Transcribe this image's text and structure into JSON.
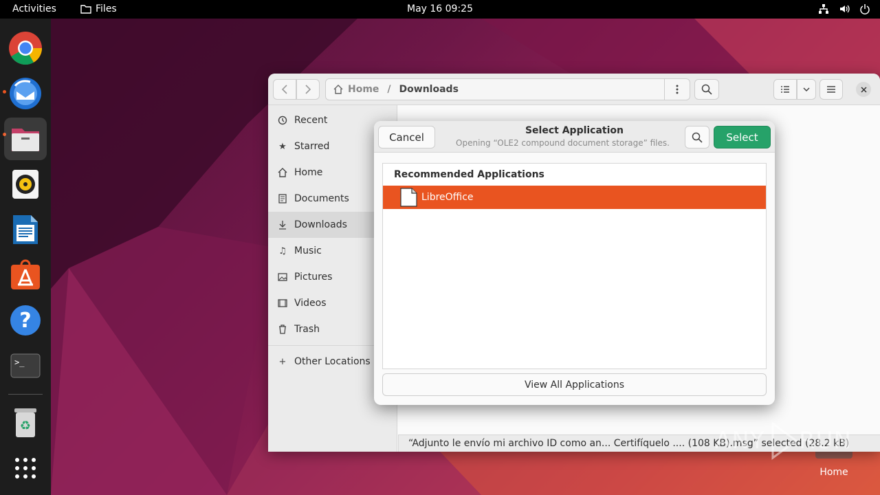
{
  "topbar": {
    "activities": "Activities",
    "app_name": "Files",
    "clock": "May 16  09:25"
  },
  "dock": {
    "items": [
      {
        "name": "chrome",
        "icon": "chrome-icon"
      },
      {
        "name": "thunderbird",
        "icon": "thunderbird-icon"
      },
      {
        "name": "files",
        "icon": "files-icon"
      },
      {
        "name": "rhythmbox",
        "icon": "rhythmbox-icon"
      },
      {
        "name": "libreoffice-writer",
        "icon": "writer-icon"
      },
      {
        "name": "app-center",
        "icon": "app-center-icon"
      },
      {
        "name": "help",
        "icon": "help-icon"
      },
      {
        "name": "terminal",
        "icon": "terminal-icon"
      },
      {
        "name": "trash",
        "icon": "trash-icon"
      },
      {
        "name": "show-apps",
        "icon": "app-grid-icon"
      }
    ]
  },
  "files": {
    "path": [
      "Home",
      "Downloads"
    ],
    "sidebar": [
      {
        "label": "Recent",
        "icon": "clock-icon"
      },
      {
        "label": "Starred",
        "icon": "star-icon"
      },
      {
        "label": "Home",
        "icon": "home-icon"
      },
      {
        "label": "Documents",
        "icon": "document-icon"
      },
      {
        "label": "Downloads",
        "icon": "download-icon"
      },
      {
        "label": "Music",
        "icon": "music-icon"
      },
      {
        "label": "Pictures",
        "icon": "picture-icon"
      },
      {
        "label": "Videos",
        "icon": "video-icon"
      },
      {
        "label": "Trash",
        "icon": "trash-icon"
      },
      {
        "label": "Other Locations",
        "icon": "plus-icon"
      }
    ],
    "status": "“Adjunto le envío mi archivo ID como an... Certifíquelo .... (108 KB).msg” selected (28.2 kB)"
  },
  "dialog": {
    "title": "Select Application",
    "subtitle": "Opening “OLE2 compound document storage” files.",
    "cancel": "Cancel",
    "select": "Select",
    "section_title": "Recommended Applications",
    "apps": [
      {
        "name": "LibreOffice",
        "icon": "libreoffice-icon"
      }
    ],
    "view_all": "View All Applications"
  },
  "desktop": {
    "home_label": "Home"
  },
  "watermark": "ANY.RUN",
  "colors": {
    "accent": "#e95420",
    "select_button": "#26a269"
  }
}
